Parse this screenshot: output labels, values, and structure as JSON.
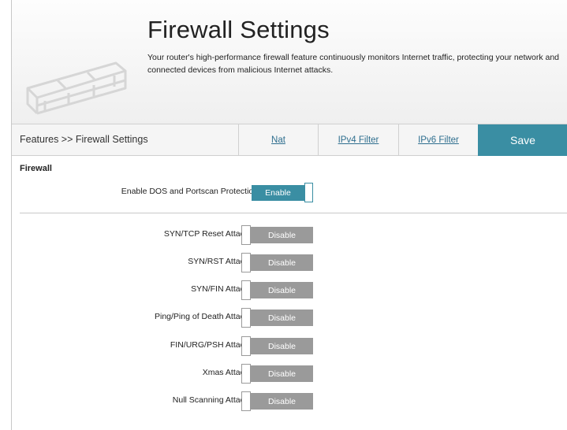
{
  "header": {
    "title": "Firewall Settings",
    "description": "Your router's high-performance firewall feature continuously monitors Internet traffic, protecting your network and connected devices from malicious Internet attacks."
  },
  "tabbar": {
    "breadcrumb": "Features >> Firewall Settings",
    "tabs": [
      "Nat",
      "IPv4 Filter",
      "IPv6 Filter"
    ],
    "save_label": "Save"
  },
  "firewall": {
    "section_title": "Firewall",
    "dos_label": "Enable DOS and Portscan Protection:",
    "dos_state": "Enable",
    "attacks": [
      {
        "label": "SYN/TCP Reset Attack:",
        "state": "Disable"
      },
      {
        "label": "SYN/RST Attack:",
        "state": "Disable"
      },
      {
        "label": "SYN/FIN Attack:",
        "state": "Disable"
      },
      {
        "label": "Ping/Ping of Death Attack:",
        "state": "Disable"
      },
      {
        "label": "FIN/URG/PSH Attack:",
        "state": "Disable"
      },
      {
        "label": "Xmas Attack:",
        "state": "Disable"
      },
      {
        "label": "Null Scanning Attack:",
        "state": "Disable"
      }
    ]
  },
  "colors": {
    "accent": "#3a8ea3",
    "disabled": "#9a9a9a",
    "link": "#2f6f8f"
  }
}
